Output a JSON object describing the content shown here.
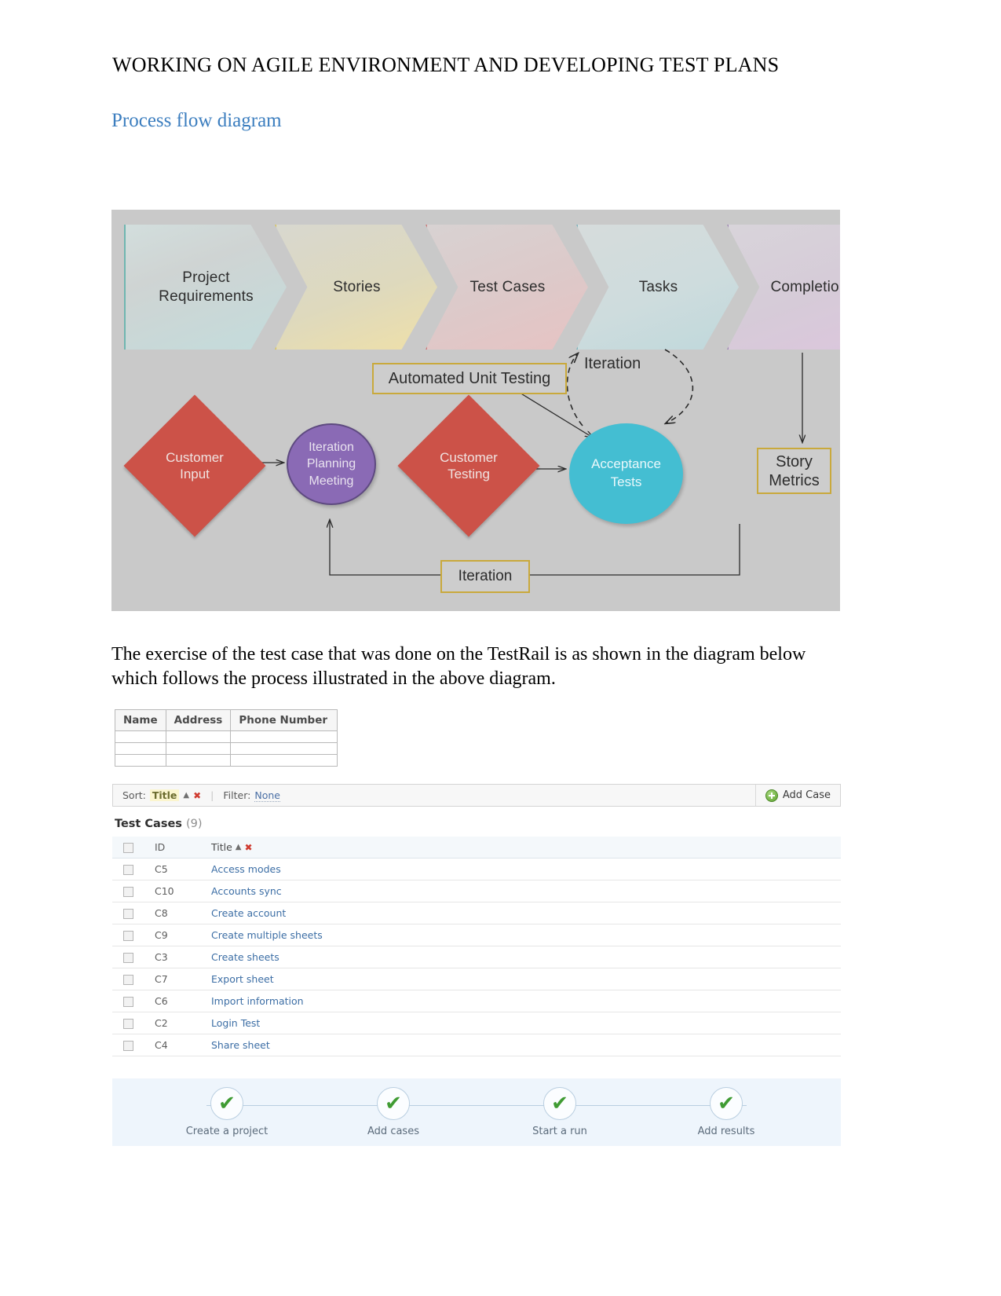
{
  "document": {
    "title": "WORKING ON AGILE ENVIRONMENT AND DEVELOPING TEST PLANS",
    "heading": "Process flow diagram",
    "paragraph": "The exercise of the test case that was done on the TestRail is as shown in the diagram below which follows the process illustrated in the above diagram."
  },
  "diagram": {
    "background_color": "#c9c9c9",
    "chevrons": [
      {
        "label": "Project Requirements",
        "accent": "#6fb6b0"
      },
      {
        "label": "Stories",
        "accent": "#d8c45c"
      },
      {
        "label": "Test Cases",
        "accent": "#cc7c7c"
      },
      {
        "label": "Tasks",
        "accent": "#7fb4bd"
      },
      {
        "label": "Completion",
        "accent": "#a08ab4"
      }
    ],
    "automated_unit_testing": "Automated Unit Testing",
    "iteration_top": "Iteration",
    "iteration_bottom": "Iteration",
    "story_metrics": "Story Metrics",
    "customer_input": "Customer Input",
    "iteration_planning_meeting": "Iteration Planning Meeting",
    "customer_testing": "Customer Testing",
    "acceptance_tests": "Acceptance Tests",
    "colors": {
      "diamond": "#cc5248",
      "ellipse_planning": "#8a6ab5",
      "ellipse_acceptance": "#44bed2",
      "gold_border": "#c9a93c"
    }
  },
  "mini_table": {
    "headers": [
      "Name",
      "Address",
      "Phone Number"
    ],
    "empty_rows": 3
  },
  "testrail": {
    "toolbar": {
      "sort_key": "Sort:",
      "sort_value": "Title",
      "sort_dir_icon": "▲",
      "sort_clear_icon": "✖",
      "filter_key": "Filter:",
      "filter_value": "None",
      "add_case_label": "Add Case",
      "add_icon": "plus-circle-icon"
    },
    "section": {
      "title": "Test Cases",
      "count": "(9)"
    },
    "columns": {
      "id": "ID",
      "title": "Title",
      "sort_dir_icon": "▲",
      "sort_clear_icon": "✖"
    },
    "rows": [
      {
        "id": "C5",
        "title": "Access modes"
      },
      {
        "id": "C10",
        "title": "Accounts sync"
      },
      {
        "id": "C8",
        "title": "Create account"
      },
      {
        "id": "C9",
        "title": "Create multiple sheets"
      },
      {
        "id": "C3",
        "title": "Create sheets"
      },
      {
        "id": "C7",
        "title": "Export sheet"
      },
      {
        "id": "C6",
        "title": "Import information"
      },
      {
        "id": "C2",
        "title": "Login Test"
      },
      {
        "id": "C4",
        "title": "Share sheet"
      }
    ],
    "wizard": {
      "steps": [
        {
          "label": "Create a project",
          "icon": "green-check-icon"
        },
        {
          "label": "Add cases",
          "icon": "green-check-icon"
        },
        {
          "label": "Start a run",
          "icon": "green-check-icon"
        },
        {
          "label": "Add results",
          "icon": "green-check-icon"
        }
      ],
      "check_glyph": "✔",
      "background_color": "#eef5fc"
    }
  }
}
